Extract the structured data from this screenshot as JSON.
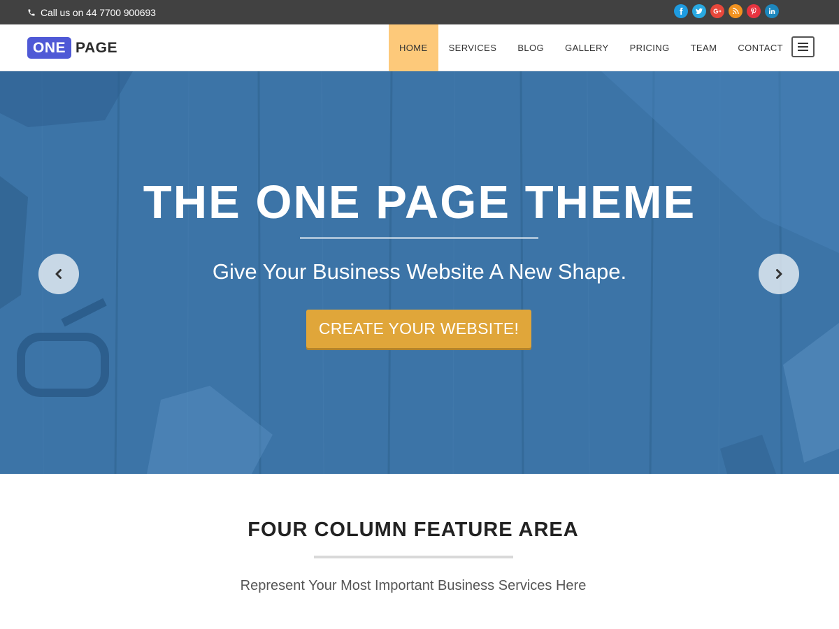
{
  "topbar": {
    "phone_text": "Call us on 44 7700 900693",
    "phone_icon": "phone-icon",
    "socials": [
      {
        "name": "facebook",
        "icon": "facebook-icon",
        "color": "#1e9be0"
      },
      {
        "name": "twitter",
        "icon": "twitter-icon",
        "color": "#29a9e1"
      },
      {
        "name": "google-plus",
        "icon": "google-plus-icon",
        "color": "#e8473b"
      },
      {
        "name": "rss",
        "icon": "rss-icon",
        "color": "#f2921f"
      },
      {
        "name": "pinterest",
        "icon": "pinterest-icon",
        "color": "#e7333f"
      },
      {
        "name": "linkedin",
        "icon": "linkedin-icon",
        "color": "#1d87bd"
      }
    ]
  },
  "header": {
    "logo_box_text": "ONE",
    "logo_text": "PAGE",
    "nav": [
      "HOME",
      "SERVICES",
      "BLOG",
      "GALLERY",
      "PRICING",
      "TEAM",
      "CONTACT"
    ],
    "active_nav": "HOME",
    "menu_icon": "hamburger-menu-icon"
  },
  "hero": {
    "title": "THE ONE PAGE THEME",
    "subtitle": "Give Your Business Website A New Shape.",
    "cta_label": "CREATE YOUR WEBSITE!",
    "prev_icon": "chevron-left-icon",
    "next_icon": "chevron-right-icon",
    "overlay_color": "#3b73a6",
    "cta_color": "#e0a63a"
  },
  "features": {
    "title": "FOUR COLUMN FEATURE AREA",
    "subtitle": "Represent Your Most Important Business Services Here"
  },
  "colors": {
    "topbar": "#414141",
    "brand": "#4f59d6",
    "nav_active": "#fdc97a"
  }
}
